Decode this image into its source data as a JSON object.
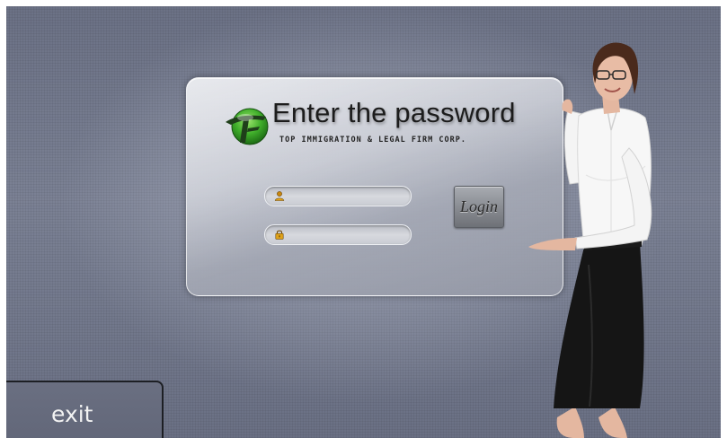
{
  "login_panel": {
    "title": "Enter the password",
    "subtitle": "TOP IMMIGRATION & LEGAL FIRM CORP.",
    "username_field": {
      "value": "",
      "placeholder": "",
      "icon": "user-icon"
    },
    "password_field": {
      "value": "",
      "placeholder": "",
      "icon": "lock-icon"
    },
    "login_label": "Login"
  },
  "exit_label": "exit",
  "colors": {
    "background": "#72788b",
    "panel": "#c4c7cf",
    "logo_green": "#3fae2a",
    "exit_border": "#1d1f24"
  }
}
